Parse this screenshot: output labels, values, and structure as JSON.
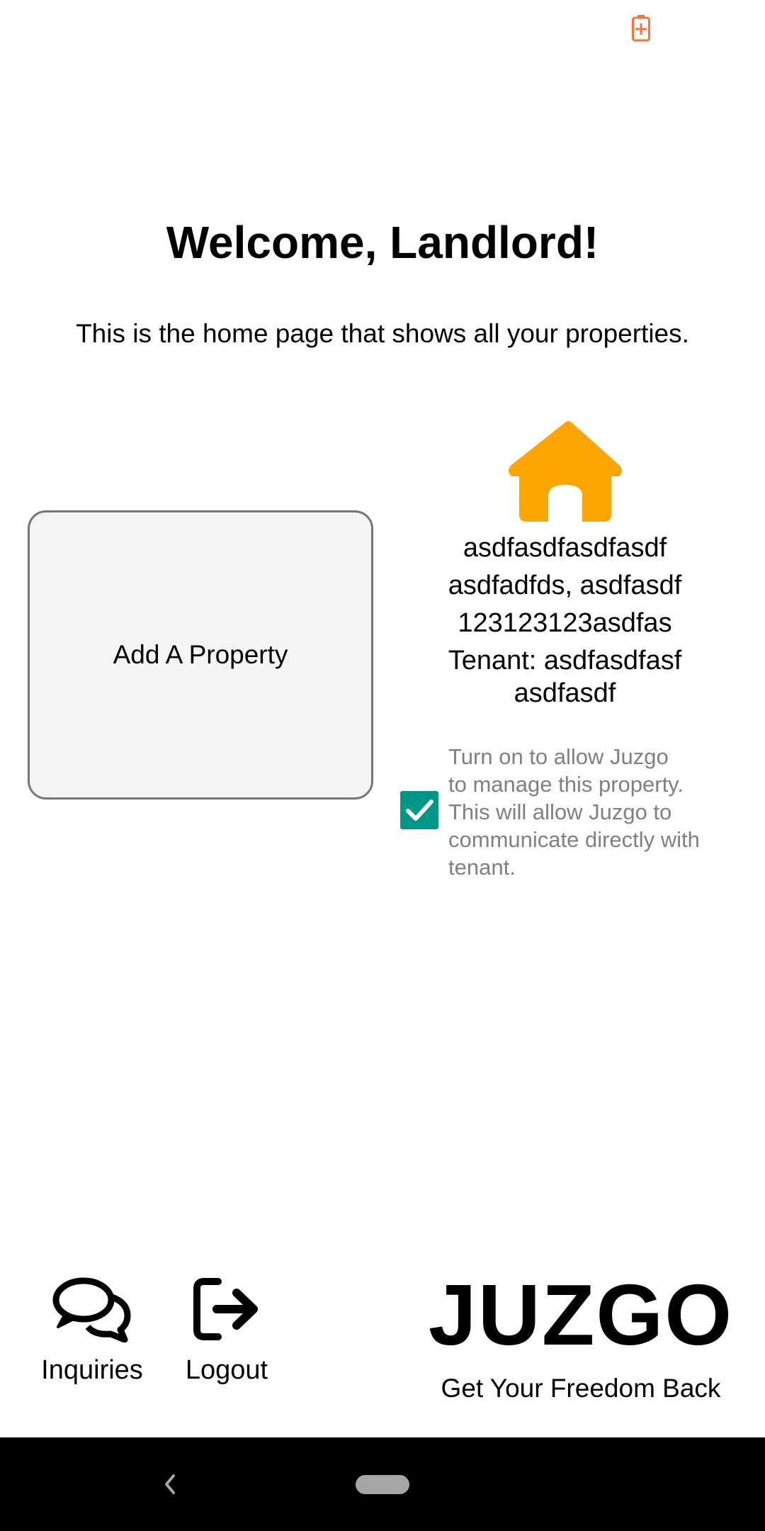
{
  "status_bar": {
    "battery_icon": "battery-charging-icon",
    "battery_color": "#ff6f3c"
  },
  "header": {
    "title": "Welcome, Landlord!",
    "subtitle": "This is the home page that shows all your properties."
  },
  "add_property": {
    "label": "Add A Property"
  },
  "property": {
    "icon": "house-icon",
    "icon_color": "#ffa500",
    "name": "asdfasdfasdfasdf",
    "address": "asdfadfds, asdfasdf",
    "zip": "123123123asdfas",
    "tenant": "Tenant: asdfasdfasf",
    "tenant_extra": "asdfasdf"
  },
  "manage": {
    "checked": true,
    "accent_color": "#009688",
    "text": "Turn on to allow Juzgo\nto manage this property.\nThis will allow Juzgo to\ncommunicate directly with\ntenant."
  },
  "bottom_nav": {
    "inquiries_icon": "chat-bubbles-icon",
    "inquiries_label": "Inquiries",
    "logout_icon": "logout-icon",
    "logout_label": "Logout"
  },
  "brand": {
    "name": "JUZGO",
    "tagline": "Get Your Freedom Back"
  },
  "system_nav": {
    "back_icon": "back-chevron-icon",
    "home_icon": "home-pill-icon"
  }
}
